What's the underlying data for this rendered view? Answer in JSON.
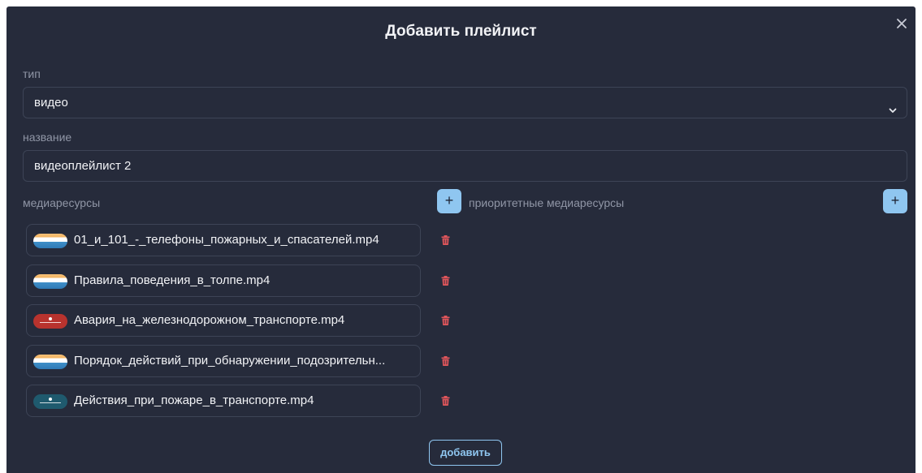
{
  "dialog": {
    "title": "Добавить плейлист"
  },
  "type_field": {
    "label": "тип",
    "value": "видео"
  },
  "name_field": {
    "label": "название",
    "value": "видеоплейлист 2"
  },
  "media": {
    "label": "медиаресурсы",
    "items": [
      {
        "name": "01_и_101_-_телефоны_пожарных_и_спасателей.mp4",
        "thumbnail": "flag"
      },
      {
        "name": "Правила_поведения_в_толпе.mp4",
        "thumbnail": "flag"
      },
      {
        "name": "Авария_на_железнодорожном_транспорте.mp4",
        "thumbnail": "red"
      },
      {
        "name": "Порядок_действий_при_обнаружении_подозрительн...",
        "thumbnail": "flag"
      },
      {
        "name": "Действия_при_пожаре_в_транспорте.mp4",
        "thumbnail": "teal"
      }
    ]
  },
  "priority_media": {
    "label": "приоритетные медиаресурсы",
    "items": []
  },
  "buttons": {
    "plus": "+",
    "submit": "добавить"
  },
  "colors": {
    "background": "#262b3b",
    "border": "#3d4456",
    "accent": "#8fc6f0",
    "delete": "#e0565b",
    "muted_text": "#9096a6"
  }
}
